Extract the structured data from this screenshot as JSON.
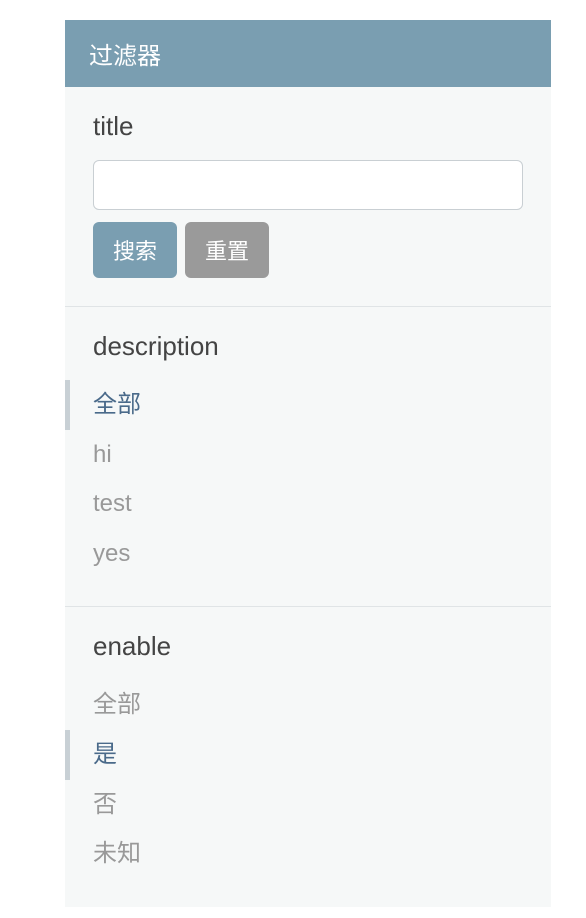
{
  "header": {
    "title": "过滤器"
  },
  "sections": {
    "title": {
      "label": "title",
      "input_value": "",
      "search_label": "搜索",
      "reset_label": "重置"
    },
    "description": {
      "label": "description",
      "items": [
        "全部",
        "hi",
        "test",
        "yes"
      ],
      "selected_index": 0
    },
    "enable": {
      "label": "enable",
      "items": [
        "全部",
        "是",
        "否",
        "未知"
      ],
      "selected_index": 1
    }
  }
}
